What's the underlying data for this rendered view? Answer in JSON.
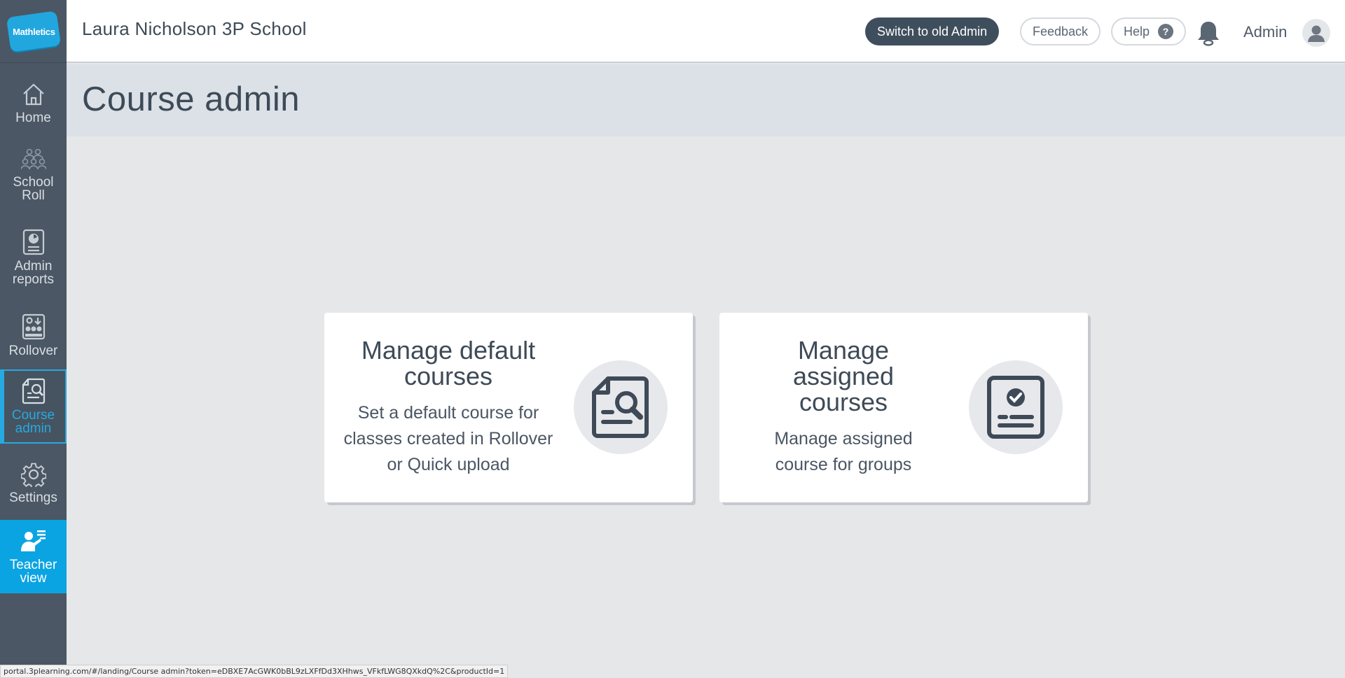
{
  "brand": {
    "logo_text": "Mathletics"
  },
  "sidebar": {
    "items": [
      {
        "label_line1": "Home",
        "label_line2": "",
        "icon": "home-icon"
      },
      {
        "label_line1": "School",
        "label_line2": "Roll",
        "icon": "people-icon"
      },
      {
        "label_line1": "Admin",
        "label_line2": "reports",
        "icon": "report-icon"
      },
      {
        "label_line1": "Rollover",
        "label_line2": "",
        "icon": "rollover-icon"
      },
      {
        "label_line1": "Course",
        "label_line2": "admin",
        "icon": "course-icon",
        "active": true
      },
      {
        "label_line1": "Settings",
        "label_line2": "",
        "icon": "gear-icon"
      },
      {
        "label_line1": "Teacher",
        "label_line2": "view",
        "icon": "teacher-icon"
      }
    ]
  },
  "header": {
    "school_name": "Laura Nicholson 3P School",
    "switch_label": "Switch to old Admin",
    "feedback_label": "Feedback",
    "help_label": "Help",
    "help_glyph": "?",
    "user_label": "Admin"
  },
  "page": {
    "title": "Course admin"
  },
  "cards": [
    {
      "title": "Manage default courses",
      "description": "Set a default course for classes created in Rollover or Quick upload",
      "icon": "document-search-icon"
    },
    {
      "title": "Manage assigned courses",
      "description": "Manage assigned course for groups",
      "icon": "document-check-icon"
    }
  ],
  "status_url": "portal.3plearning.com/#/landing/Course admin?token=eDBXE7AcGWK0bBL9zLXFfDd3XHhws_VFkfLWG8QXkdQ%2C&productId=1",
  "colors": {
    "sidebar": "#4b5764",
    "accent": "#27a9e1",
    "teacher_bg": "#0ba4e3",
    "dark_button": "#3f4e5d"
  }
}
